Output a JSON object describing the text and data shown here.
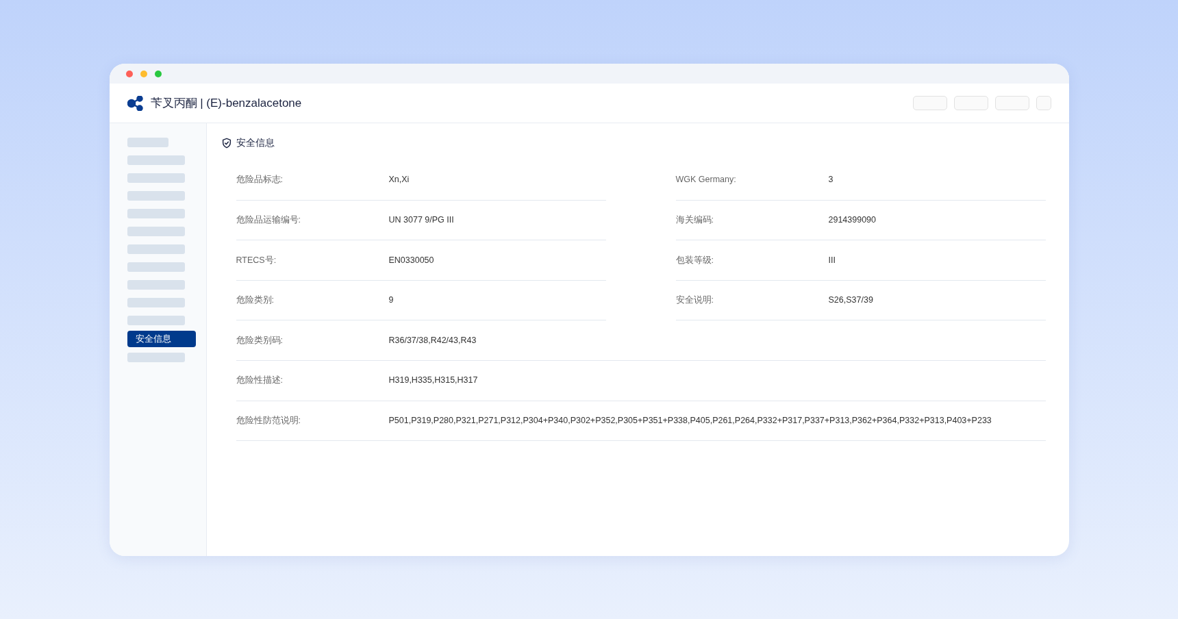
{
  "window": {
    "title": "苄叉丙酮 | (E)-benzalacetone"
  },
  "sidebar": {
    "items": [
      {
        "kind": "skeleton_short"
      },
      {
        "kind": "skeleton"
      },
      {
        "kind": "skeleton"
      },
      {
        "kind": "skeleton"
      },
      {
        "kind": "skeleton"
      },
      {
        "kind": "skeleton"
      },
      {
        "kind": "skeleton"
      },
      {
        "kind": "skeleton"
      },
      {
        "kind": "skeleton"
      },
      {
        "kind": "skeleton"
      },
      {
        "kind": "skeleton"
      },
      {
        "kind": "link",
        "label": "安全信息",
        "selected": true
      },
      {
        "kind": "skeleton"
      }
    ]
  },
  "section": {
    "title": "安全信息",
    "rows": [
      {
        "cells": [
          {
            "label": "危险品标志:",
            "value": "Xn,Xi"
          },
          {
            "label": "WGK Germany:",
            "value": "3"
          }
        ]
      },
      {
        "cells": [
          {
            "label": "危险品运输编号:",
            "value": "UN 3077 9/PG III"
          },
          {
            "label": "海关编码:",
            "value": "2914399090"
          }
        ]
      },
      {
        "cells": [
          {
            "label": "RTECS号:",
            "value": "EN0330050"
          },
          {
            "label": "包装等级:",
            "value": "III"
          }
        ]
      },
      {
        "cells": [
          {
            "label": "危险类别:",
            "value": "9"
          },
          {
            "label": "安全说明:",
            "value": "S26,S37/39"
          }
        ]
      },
      {
        "cells": [
          {
            "label": "危险类别码:",
            "value": "R36/37/38,R42/43,R43"
          }
        ]
      },
      {
        "cells": [
          {
            "label": "危险性描述:",
            "value": "H319,H335,H315,H317"
          }
        ]
      },
      {
        "cells": [
          {
            "label": "危险性防范说明:",
            "value": "P501,P319,P280,P321,P271,P312,P304+P340,P302+P352,P305+P351+P338,P405,P261,P264,P332+P317,P337+P313,P362+P364,P332+P313,P403+P233"
          }
        ]
      }
    ]
  }
}
